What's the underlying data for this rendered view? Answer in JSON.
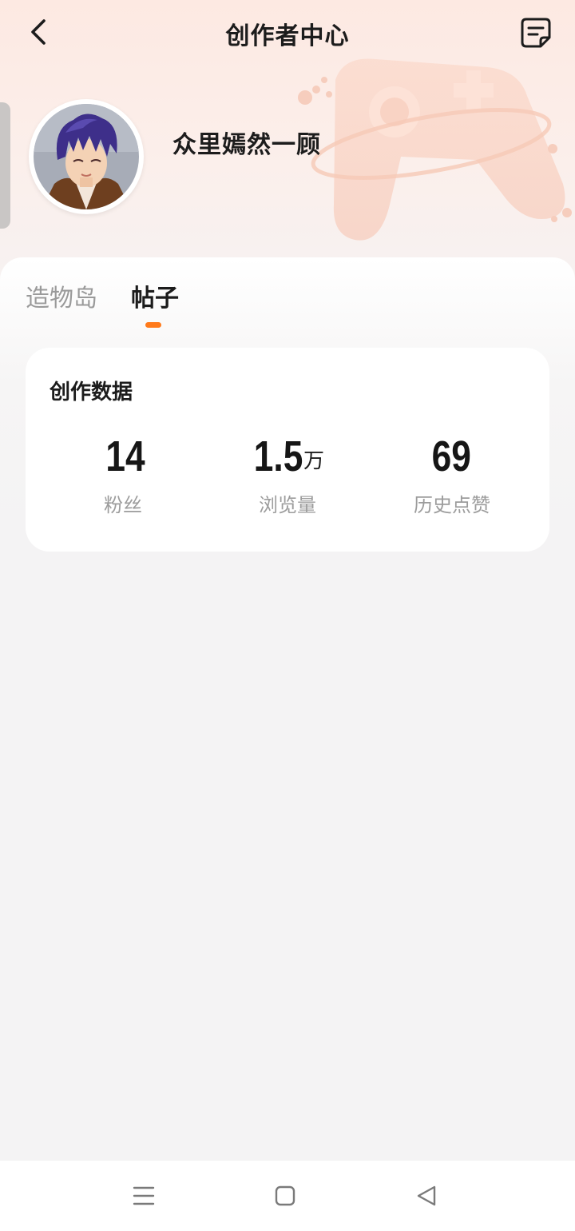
{
  "header": {
    "title": "创作者中心",
    "back_icon": "chevron-left-icon",
    "note_icon": "edit-note-icon"
  },
  "profile": {
    "username": "众里嫣然一顾"
  },
  "tabs": [
    {
      "label": "造物岛",
      "active": false
    },
    {
      "label": "帖子",
      "active": true
    }
  ],
  "stats_card": {
    "title": "创作数据",
    "stats": [
      {
        "value": "14",
        "unit": "",
        "label": "粉丝"
      },
      {
        "value": "1.5",
        "unit": "万",
        "label": "浏览量"
      },
      {
        "value": "69",
        "unit": "",
        "label": "历史点赞"
      }
    ]
  },
  "nav_bar": {
    "menu_icon": "menu-icon",
    "home_icon": "square-home-icon",
    "back_icon": "triangle-back-icon"
  },
  "colors": {
    "accent": "#ff7a1a",
    "header_gradient_top": "#fde9e2",
    "background": "#f4f3f4"
  }
}
